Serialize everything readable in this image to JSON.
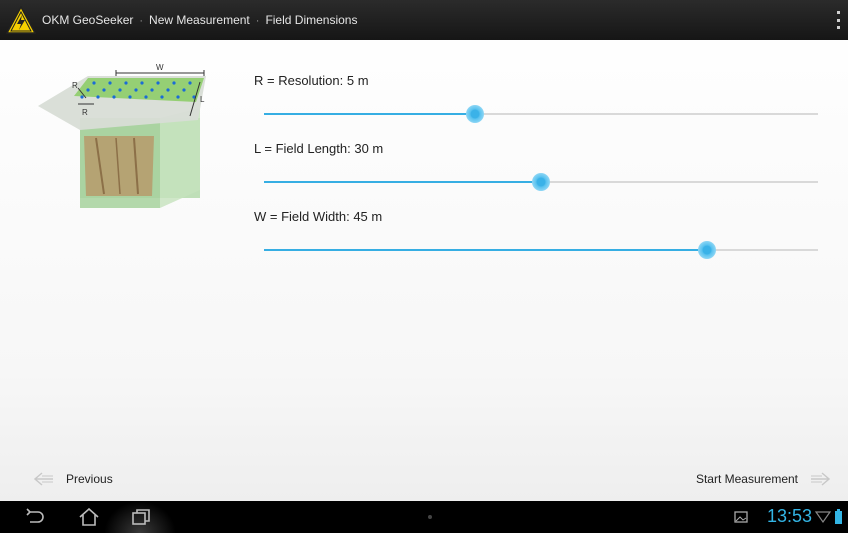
{
  "actionbar": {
    "app_name": "OKM GeoSeeker",
    "crumb1": "New Measurement",
    "crumb2": "Field Dimensions",
    "separator": "·"
  },
  "illustration": {
    "label_w": "W",
    "label_l": "L",
    "label_r_top": "R",
    "label_r_bottom": "R"
  },
  "settings": [
    {
      "label": "R = Resolution: 5 m",
      "value": 5,
      "fraction": 0.38
    },
    {
      "label": "L = Field Length: 30 m",
      "value": 30,
      "fraction": 0.5
    },
    {
      "label": "W = Field Width: 45 m",
      "value": 45,
      "fraction": 0.8
    }
  ],
  "nav": {
    "previous": "Previous",
    "next": "Start Measurement"
  },
  "system_bar": {
    "time": "13:53"
  },
  "colors": {
    "accent": "#33b5e5",
    "actionbar": "#1f1f1f",
    "track": "#d9d9d9"
  }
}
